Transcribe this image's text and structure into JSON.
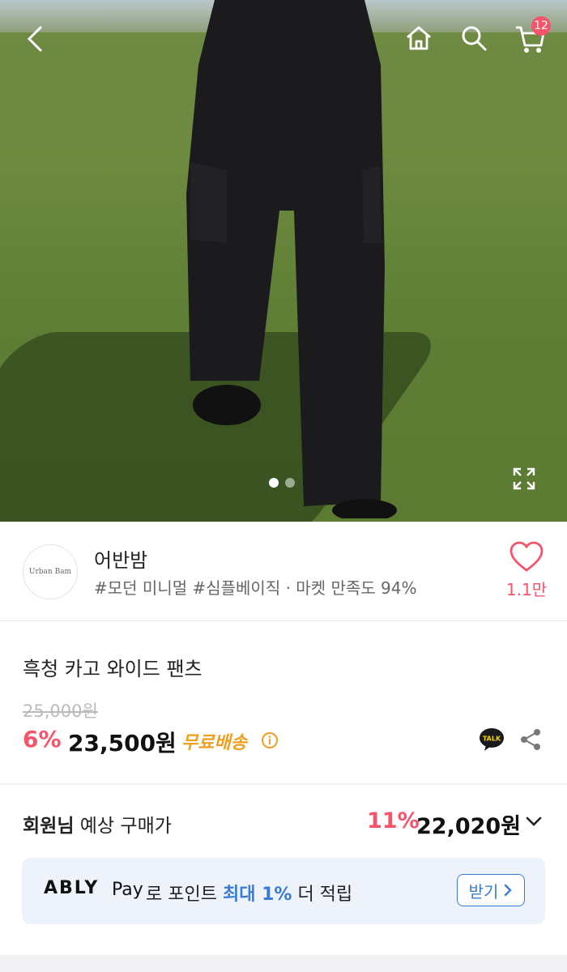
{
  "topbar": {
    "cart_count": "12"
  },
  "gallery": {
    "total": 2,
    "active": 0
  },
  "store": {
    "logo_text": "Urban Bam",
    "name": "어반밤",
    "tags": "#모던 미니멀 #심플베이직 · 마켓 만족도 94%",
    "likes": "1.1만"
  },
  "product": {
    "name": "흑청 카고 와이드 팬츠",
    "original_price": "25,000원",
    "discount": "6%",
    "price": "23,500원",
    "shipping": "무료배송",
    "talk_label": "TALK"
  },
  "member": {
    "label_bold": "회원님",
    "label_rest": " 예상 구매가",
    "discount": "11%",
    "price": "22,020원"
  },
  "banner": {
    "brand": "ABLY",
    "pay": "Pay",
    "text_pre": "로 포인트 ",
    "text_hl": "최대 1%",
    "text_post": " 더 적립",
    "button": "받기"
  },
  "colors": {
    "accent": "#f5546a",
    "blue": "#3a7bd5",
    "shipping": "#f0a020"
  }
}
